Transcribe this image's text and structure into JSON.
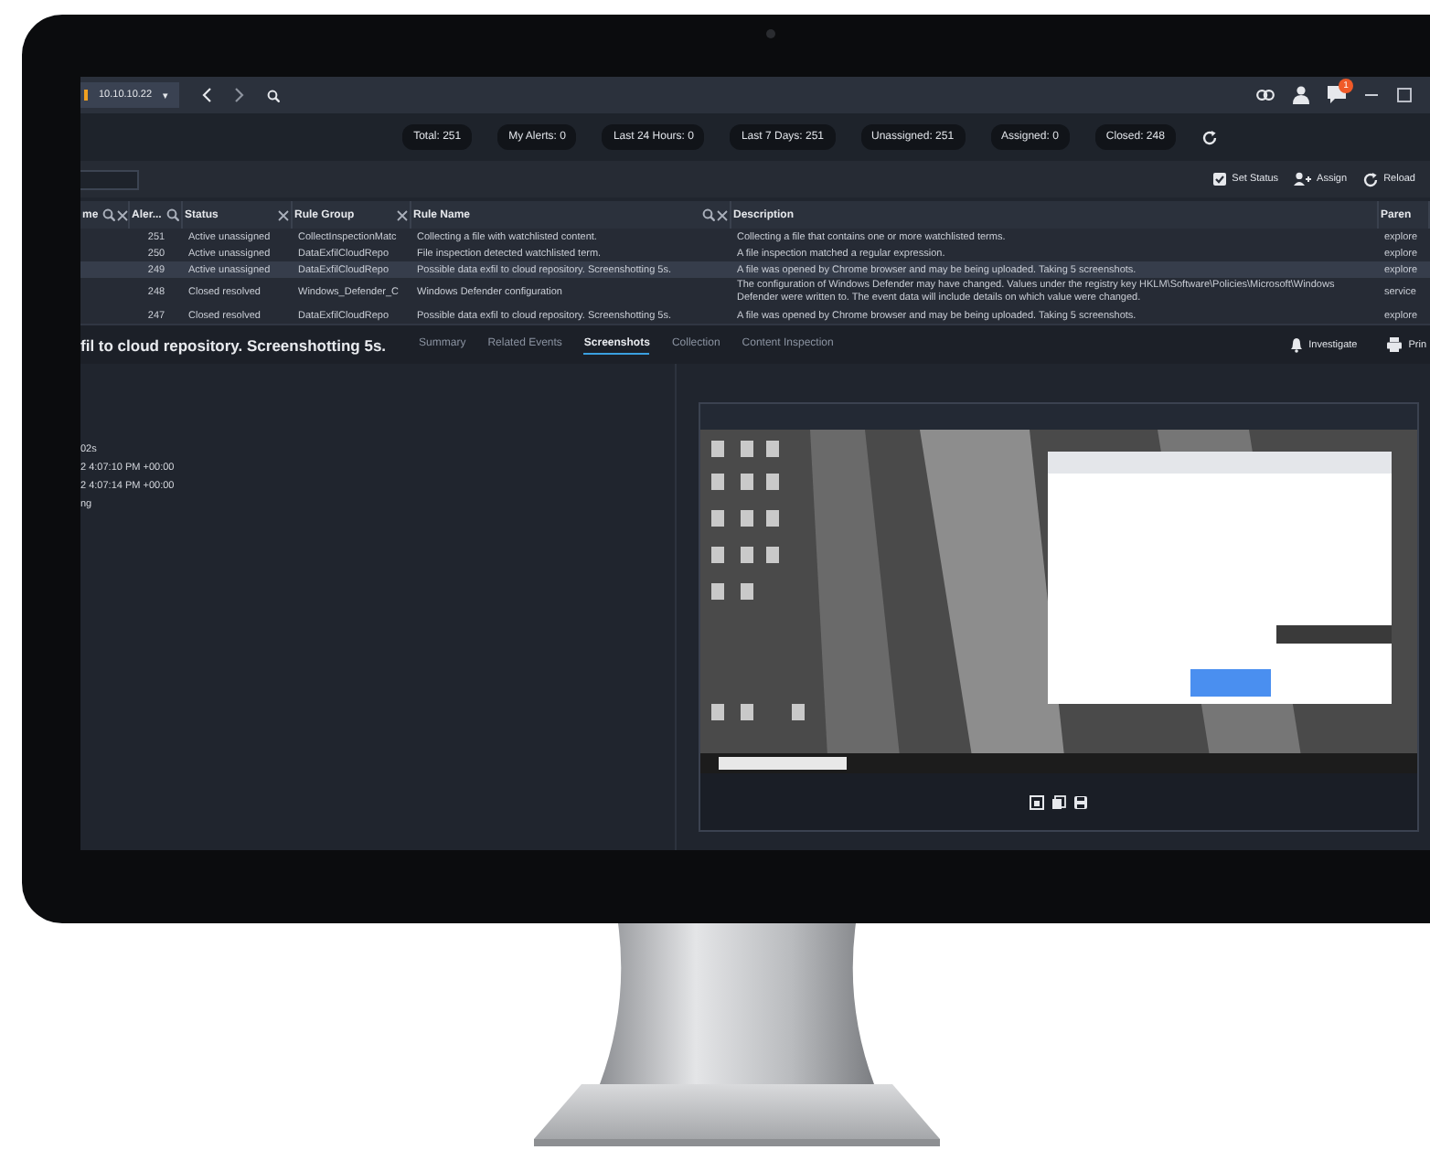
{
  "header": {
    "server": "10.10.10.22",
    "caret": "▾",
    "notifications": "1"
  },
  "stats": [
    "Total: 251",
    "My Alerts: 0",
    "Last 24 Hours: 0",
    "Last 7 Days: 251",
    "Unassigned: 251",
    "Assigned: 0",
    "Closed: 248"
  ],
  "actions": [
    {
      "kind": "status",
      "label": "Set Status"
    },
    {
      "kind": "assign",
      "label": "Assign"
    },
    {
      "kind": "reload",
      "label": "Reload"
    }
  ],
  "table": {
    "columns": [
      {
        "label": "me",
        "search": true,
        "clear": true
      },
      {
        "label": "Aler...",
        "search": true,
        "clear": false
      },
      {
        "label": "Status",
        "search": false,
        "clear": true
      },
      {
        "label": "Rule Group",
        "search": false,
        "clear": true
      },
      {
        "label": "Rule Name",
        "search": true,
        "clear": true
      },
      {
        "label": "Description",
        "search": false,
        "clear": false
      },
      {
        "label": "Paren",
        "search": false,
        "clear": false
      }
    ],
    "rows": [
      {
        "selected": false,
        "cells": [
          "",
          "251",
          "Active unassigned",
          "CollectInspectionMatc",
          "Collecting a file with watchlisted content.",
          "Collecting a file that contains one or more watchlisted terms.",
          "explore"
        ]
      },
      {
        "selected": false,
        "cells": [
          "",
          "250",
          "Active unassigned",
          "DataExfilCloudRepo",
          "File inspection detected watchlisted term.",
          "A file inspection matched a regular expression.",
          "explore"
        ]
      },
      {
        "selected": true,
        "cells": [
          "",
          "249",
          "Active unassigned",
          "DataExfilCloudRepo",
          "Possible data exfil to cloud repository. Screenshotting 5s.",
          "A file was opened by Chrome browser and may be being uploaded. Taking 5 screenshots.",
          "explore"
        ]
      },
      {
        "selected": false,
        "cells": [
          "",
          "248",
          "Closed resolved",
          "Windows_Defender_C",
          "Windows Defender configuration",
          "The configuration of Windows Defender may have changed. Values under the registry key HKLM\\Software\\Policies\\Microsoft\\Windows Defender were written to. The event data will include details on which value were changed.",
          "service"
        ]
      },
      {
        "selected": false,
        "cells": [
          "",
          "247",
          "Closed resolved",
          "DataExfilCloudRepo",
          "Possible data exfil to cloud repository. Screenshotting 5s.",
          "A file was opened by Chrome browser and may be being uploaded. Taking 5 screenshots.",
          "explore"
        ]
      }
    ]
  },
  "detail": {
    "title": "fil to cloud repository. Screenshotting 5s.",
    "tabs": [
      {
        "label": "Summary",
        "selected": false
      },
      {
        "label": "Related Events",
        "selected": false
      },
      {
        "label": "Screenshots",
        "selected": true
      },
      {
        "label": "Collection",
        "selected": false
      },
      {
        "label": "Content Inspection",
        "selected": false
      }
    ],
    "actions": [
      {
        "kind": "investigate",
        "label": "Investigate"
      },
      {
        "kind": "print",
        "label": "Prin"
      }
    ],
    "fields": [
      "02s",
      "2 4:07:10 PM +00:00",
      "2 4:07:14 PM +00:00",
      "ng"
    ]
  }
}
